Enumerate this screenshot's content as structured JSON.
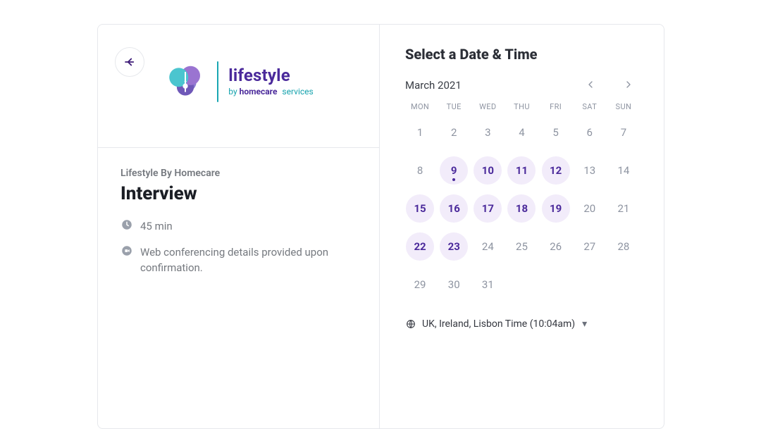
{
  "brand": {
    "word_main": "lifestyle",
    "word_sub_prefix": "by",
    "word_sub_bold": "homecare",
    "word_sub_rest": "services"
  },
  "left": {
    "company": "Lifestyle By Homecare",
    "title": "Interview",
    "duration": "45 min",
    "conferencing": "Web conferencing details provided upon confirmation."
  },
  "right": {
    "title": "Select a Date & Time",
    "month_label": "March 2021",
    "dow": [
      "MON",
      "TUE",
      "WED",
      "THU",
      "FRI",
      "SAT",
      "SUN"
    ],
    "days": [
      {
        "n": "1"
      },
      {
        "n": "2"
      },
      {
        "n": "3"
      },
      {
        "n": "4"
      },
      {
        "n": "5"
      },
      {
        "n": "6"
      },
      {
        "n": "7"
      },
      {
        "n": "8"
      },
      {
        "n": "9",
        "available": true,
        "today": true
      },
      {
        "n": "10",
        "available": true
      },
      {
        "n": "11",
        "available": true
      },
      {
        "n": "12",
        "available": true
      },
      {
        "n": "13"
      },
      {
        "n": "14"
      },
      {
        "n": "15",
        "available": true
      },
      {
        "n": "16",
        "available": true
      },
      {
        "n": "17",
        "available": true
      },
      {
        "n": "18",
        "available": true
      },
      {
        "n": "19",
        "available": true
      },
      {
        "n": "20"
      },
      {
        "n": "21"
      },
      {
        "n": "22",
        "available": true
      },
      {
        "n": "23",
        "available": true
      },
      {
        "n": "24"
      },
      {
        "n": "25"
      },
      {
        "n": "26"
      },
      {
        "n": "27"
      },
      {
        "n": "28"
      },
      {
        "n": "29"
      },
      {
        "n": "30"
      },
      {
        "n": "31"
      }
    ],
    "timezone": "UK, Ireland, Lisbon Time (10:04am)"
  }
}
